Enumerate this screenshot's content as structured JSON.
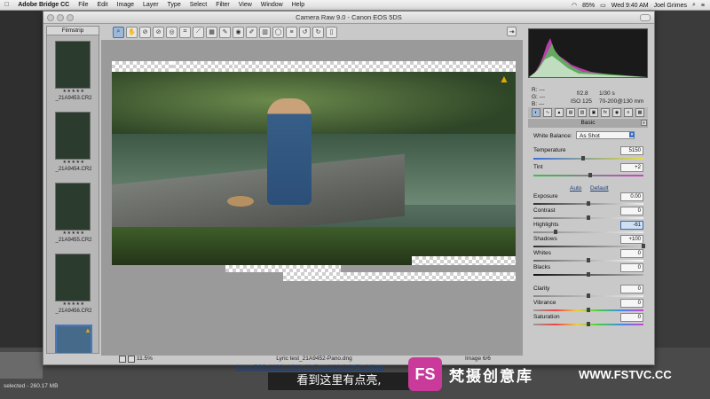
{
  "menubar": {
    "apple": "",
    "items": [
      "Adobe Bridge CC",
      "File",
      "Edit",
      "Image",
      "Layer",
      "Type",
      "Select",
      "Filter",
      "View",
      "Window",
      "Help"
    ],
    "battery": "85%",
    "clock": "Wed 9:40 AM",
    "user": "Joel Grimes"
  },
  "dialog": {
    "title": "Camera Raw 9.0  -  Canon EOS 5DS"
  },
  "filmstrip": {
    "header": "Filmstrip",
    "items": [
      {
        "name": "_21A9453.CR2",
        "stars": "★★★★★"
      },
      {
        "name": "_21A9454.CR2",
        "stars": "★★★★★"
      },
      {
        "name": "_21A9455.CR2",
        "stars": "★★★★★"
      },
      {
        "name": "_21A9456.CR2",
        "stars": "★★★★★"
      }
    ]
  },
  "preview": {
    "filename": "Lyric test_21A9452-Pano.dng",
    "image_count": "Image 6/6",
    "zoom": "11.5%",
    "footer_info": "Adobe RGB (1998); 16 bit; 2047 by 1120 (2.3MP); 240 ppi"
  },
  "bridge": {
    "status": "selected - 260.17 MB"
  },
  "camera_info": {
    "r": "R:   ---",
    "g": "G:   ---",
    "b": "B:   ---",
    "aperture": "f/2.8",
    "shutter": "1/30 s",
    "iso": "ISO 125",
    "lens": "70-200@130 mm"
  },
  "panel": {
    "title": "Basic",
    "white_balance_label": "White Balance:",
    "white_balance_value": "As Shot",
    "auto": "Auto",
    "default": "Default",
    "controls": [
      {
        "label": "Temperature",
        "value": "5150",
        "pos": 0.45
      },
      {
        "label": "Tint",
        "value": "+2",
        "pos": 0.52
      },
      {
        "label": "Exposure",
        "value": "0.00",
        "pos": 0.5
      },
      {
        "label": "Contrast",
        "value": "0",
        "pos": 0.5
      },
      {
        "label": "Highlights",
        "value": "-61",
        "pos": 0.2
      },
      {
        "label": "Shadows",
        "value": "+100",
        "pos": 1.0
      },
      {
        "label": "Whites",
        "value": "0",
        "pos": 0.5
      },
      {
        "label": "Blacks",
        "value": "0",
        "pos": 0.5
      },
      {
        "label": "Clarity",
        "value": "0",
        "pos": 0.5
      },
      {
        "label": "Vibrance",
        "value": "0",
        "pos": 0.5
      },
      {
        "label": "Saturation",
        "value": "0",
        "pos": 0.5
      }
    ]
  },
  "overlay": {
    "subtitle": "看到这里有点亮,",
    "logo": "FS",
    "brand": "梵摄创意库",
    "url": "WWW.FSTVC.CC"
  }
}
